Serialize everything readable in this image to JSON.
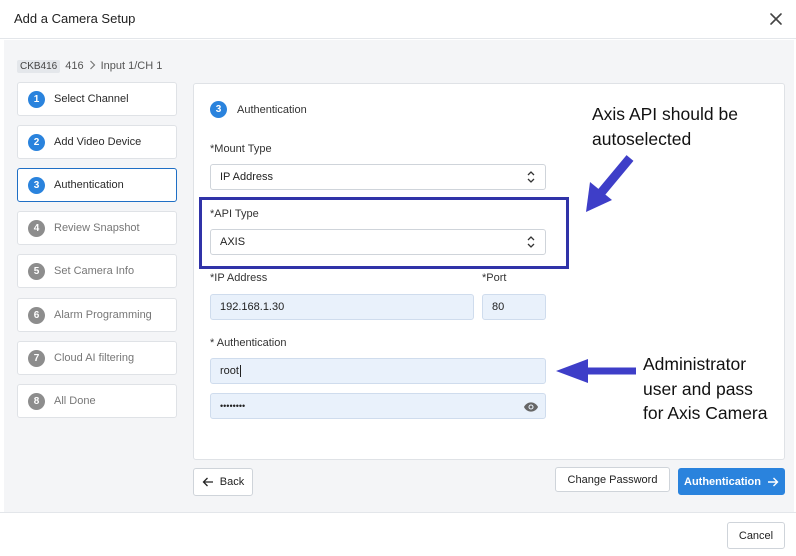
{
  "dialog": {
    "title": "Add a Camera Setup"
  },
  "breadcrumb": {
    "device_badge": "CKB416",
    "device_number": "416",
    "input": "Input 1/CH 1"
  },
  "steps": [
    {
      "number": "1",
      "label": "Select Channel"
    },
    {
      "number": "2",
      "label": "Add Video Device"
    },
    {
      "number": "3",
      "label": "Authentication"
    },
    {
      "number": "4",
      "label": "Review Snapshot"
    },
    {
      "number": "5",
      "label": "Set Camera Info"
    },
    {
      "number": "6",
      "label": "Alarm Programming"
    },
    {
      "number": "7",
      "label": "Cloud AI filtering"
    },
    {
      "number": "8",
      "label": "All Done"
    }
  ],
  "panel": {
    "step_number": "3",
    "title": "Authentication",
    "mount_type": {
      "label": "*Mount Type",
      "value": "IP Address"
    },
    "api_type": {
      "label": "*API Type",
      "value": "AXIS"
    },
    "ip_address": {
      "label": "*IP Address",
      "value": "192.168.1.30"
    },
    "port": {
      "label": "*Port",
      "value": "80"
    },
    "authentication": {
      "label": "* Authentication",
      "username": "root",
      "password_mask": "••••••••"
    }
  },
  "annotations": {
    "api_note": [
      "Axis API should be",
      "autoselected"
    ],
    "auth_note": [
      "Administrator",
      "user and pass",
      "for Axis Camera"
    ]
  },
  "buttons": {
    "back": "Back",
    "change_password": "Change Password",
    "authentication": "Authentication",
    "cancel": "Cancel"
  },
  "colors": {
    "accent": "#2a83dd",
    "annotation_box": "#3033a8",
    "annotation_arrow": "#3e3ec8"
  }
}
